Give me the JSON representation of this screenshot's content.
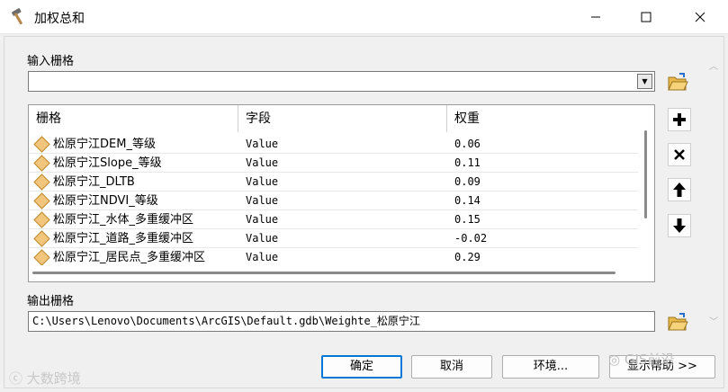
{
  "window": {
    "title": "加权总和",
    "icon": "hammer-icon"
  },
  "input_raster": {
    "label": "输入栅格",
    "value": ""
  },
  "table": {
    "headers": [
      "栅格",
      "字段",
      "权重"
    ],
    "rows": [
      {
        "raster": "松原宁江DEM_等级",
        "field": "Value",
        "weight": "0.06"
      },
      {
        "raster": "松原宁江Slope_等级",
        "field": "Value",
        "weight": "0.11"
      },
      {
        "raster": "松原宁江_DLTB",
        "field": "Value",
        "weight": "0.09"
      },
      {
        "raster": "松原宁江NDVI_等级",
        "field": "Value",
        "weight": "0.14"
      },
      {
        "raster": "松原宁江_水体_多重缓冲区",
        "field": "Value",
        "weight": "0.15"
      },
      {
        "raster": "松原宁江_道路_多重缓冲区",
        "field": "Value",
        "weight": "-0.02"
      },
      {
        "raster": "松原宁江_居民点_多重缓冲区",
        "field": "Value",
        "weight": "0.29"
      }
    ]
  },
  "side_buttons": [
    "add-icon",
    "remove-icon",
    "move-up-icon",
    "move-down-icon"
  ],
  "output_raster": {
    "label": "输出栅格",
    "value": "C:\\Users\\Lenovo\\Documents\\ArcGIS\\Default.gdb\\Weighte_松原宁江"
  },
  "footer": {
    "ok": "确定",
    "cancel": "取消",
    "env": "环境...",
    "help": "显示帮助 >>"
  },
  "watermarks": {
    "left": "大数跨境",
    "right": "GIS前沿"
  },
  "colors": {
    "accent": "#0078d7",
    "raster_icon": "#f2c57c",
    "folder": "#e8b84a"
  }
}
